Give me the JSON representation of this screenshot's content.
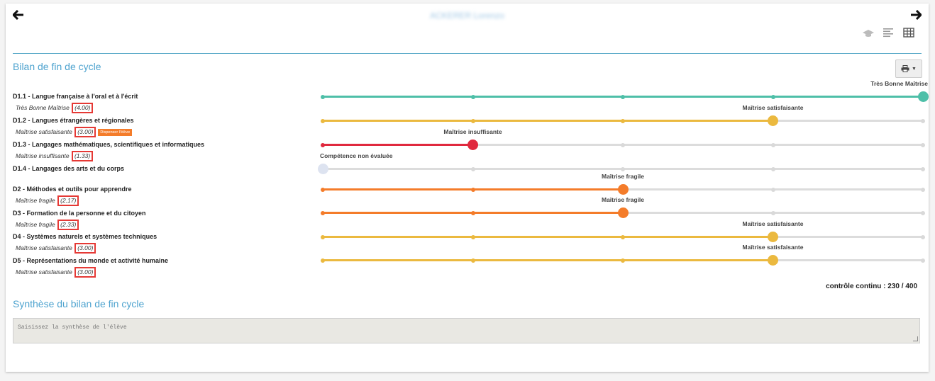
{
  "header": {
    "student_name": "ACKERER Lorenzo",
    "prev_icon": "arrow-left-icon",
    "next_icon": "arrow-right-icon",
    "view_icons": [
      "graduation-cap-icon",
      "align-left-icon",
      "table-icon"
    ]
  },
  "bilan": {
    "title": "Bilan de fin de cycle",
    "print_icon": "printer-icon",
    "domains": [
      {
        "label": "D1.1 - Langue française à l'oral et à l'écrit",
        "level_text": "Très Bonne Maîtrise",
        "score": "(4.00)",
        "level_label": "Très Bonne Maîtrise",
        "level": 4,
        "color": "#4ebfa8"
      },
      {
        "label": "D1.2 - Langues étrangères et régionales",
        "level_text": "Maîtrise satisfaisante",
        "score": "(3.00)",
        "tag": "Dispenser l'élève",
        "level_label": "Maîtrise satisfaisante",
        "level": 3,
        "color": "#ebb93f"
      },
      {
        "label": "D1.3 - Langages mathématiques, scientifiques et informatiques",
        "level_text": "Maîtrise insuffisante",
        "score": "(1.33)",
        "level_label": "Maîtrise insuffisante",
        "level": 1,
        "color": "#e0293e"
      },
      {
        "label": "D1.4 - Langages des arts et du corps",
        "level_text": "",
        "score": "",
        "level_label": "Compétence non évaluée",
        "level": 0,
        "color": "#dde3f0"
      },
      {
        "label": "D2 - Méthodes et outils pour apprendre",
        "level_text": "Maîtrise fragile",
        "score": "(2.17)",
        "level_label": "Maîtrise fragile",
        "level": 2,
        "color": "#f47c2a"
      },
      {
        "label": "D3 - Formation de la personne et du citoyen",
        "level_text": "Maîtrise fragile",
        "score": "(2.33)",
        "level_label": "Maîtrise fragile",
        "level": 2,
        "color": "#f47c2a"
      },
      {
        "label": "D4 - Systèmes naturels et systèmes techniques",
        "level_text": "Maîtrise satisfaisante",
        "score": "(3.00)",
        "level_label": "Maîtrise satisfaisante",
        "level": 3,
        "color": "#ebb93f"
      },
      {
        "label": "D5 - Représentations du monde et activité humaine",
        "level_text": "Maîtrise satisfaisante",
        "score": "(3.00)",
        "level_label": "Maîtrise satisfaisante",
        "level": 3,
        "color": "#ebb93f"
      }
    ],
    "controle_continu": "contrôle continu : 230 / 400"
  },
  "synthese": {
    "title": "Synthèse du bilan de fin cycle",
    "placeholder": "Saisissez la synthèse de l'élève"
  }
}
